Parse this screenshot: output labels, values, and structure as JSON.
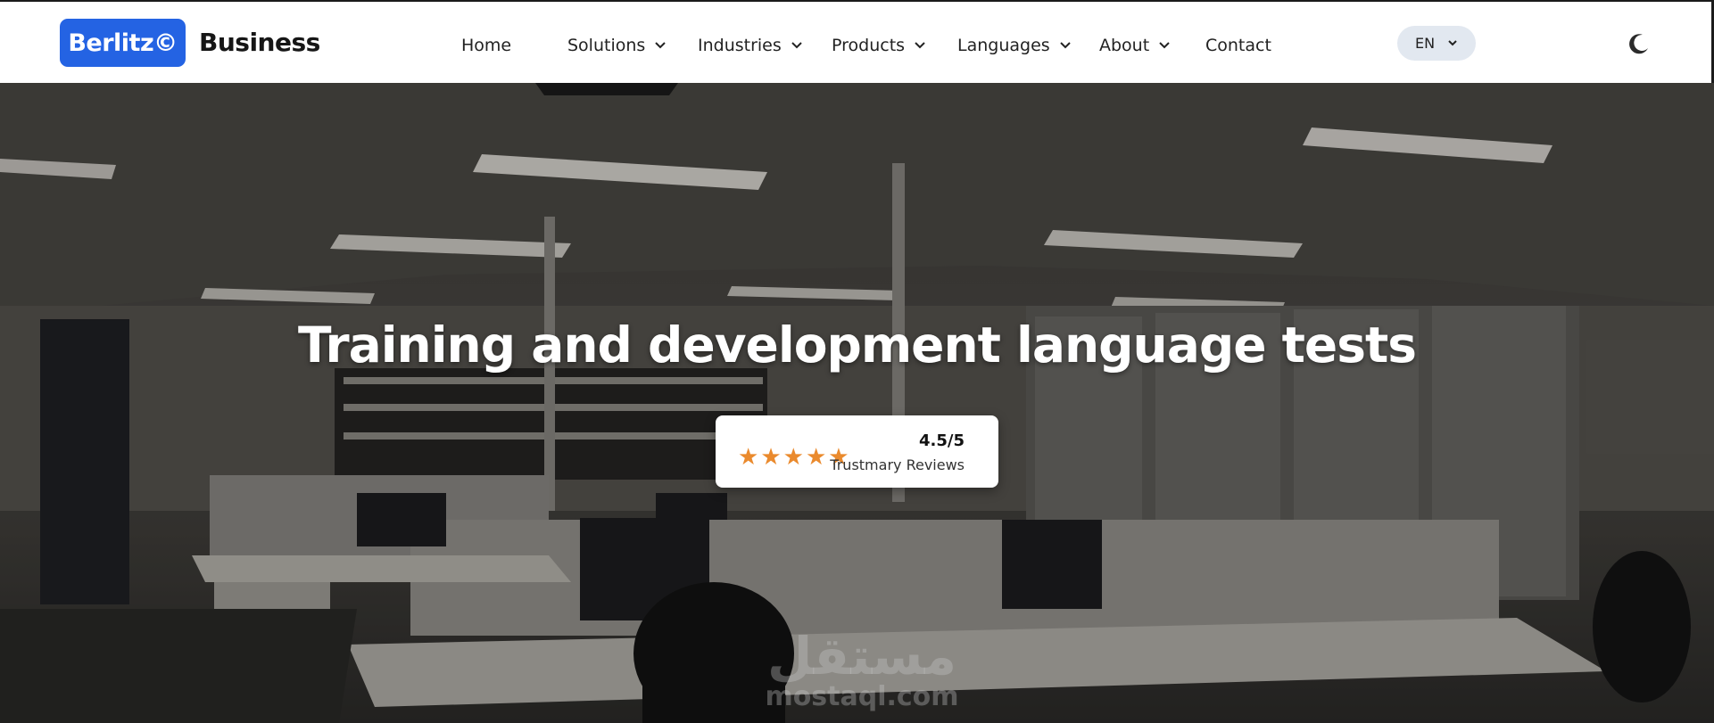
{
  "brand": {
    "logo_text": "Berlitz©",
    "suffix": "Business",
    "accent_color": "#2463e3"
  },
  "nav": {
    "items": [
      {
        "label": "Home",
        "dropdown": false
      },
      {
        "label": "Solutions",
        "dropdown": true
      },
      {
        "label": "Industries",
        "dropdown": true
      },
      {
        "label": "Products",
        "dropdown": true
      },
      {
        "label": "Languages",
        "dropdown": true
      },
      {
        "label": "About",
        "dropdown": true
      },
      {
        "label": "Contact",
        "dropdown": false
      }
    ],
    "language": {
      "selected": "EN"
    },
    "theme_toggle_icon": "moon-icon"
  },
  "hero": {
    "title": "Training and development language tests",
    "rating": {
      "score": "4.5/5",
      "source": "Trustmary Reviews",
      "stars": 5,
      "star_color": "#ea8a2d"
    }
  },
  "watermark": {
    "arabic": "مستقل",
    "latin": "mostaql.com"
  }
}
